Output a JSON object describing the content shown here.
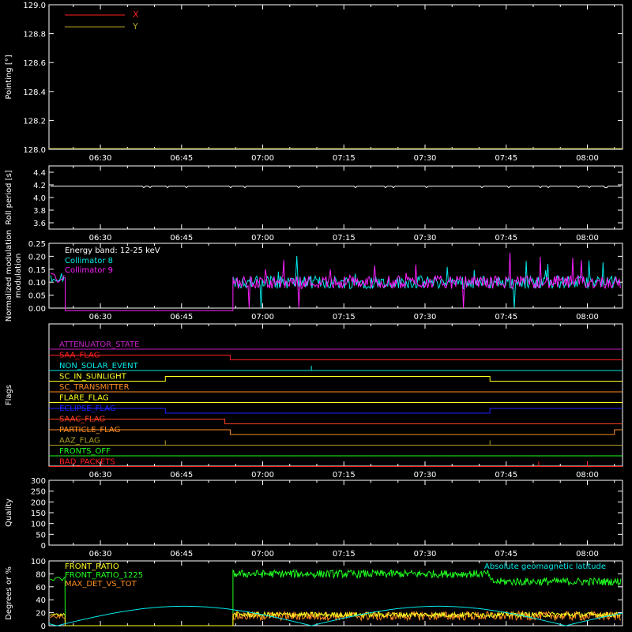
{
  "time_ticks": [
    "06:30",
    "06:45",
    "07:00",
    "07:15",
    "07:30",
    "07:45",
    "08:00"
  ],
  "colors": {
    "axis": "#ffffff",
    "red": "#ff2020",
    "olive": "#b0a020",
    "cyan": "#00e8e8",
    "magenta": "#ff20ff",
    "green": "#20ff20",
    "orange": "#ff8c20",
    "yellow": "#ffff20",
    "blue": "#2020ff",
    "purple": "#c020c0",
    "redorange": "#ff4020"
  },
  "chart_data": [
    {
      "id": "pointing",
      "type": "line",
      "ylabel": "Pointing [°]",
      "ylim": [
        128.0,
        129.0
      ],
      "yticks": [
        "128.0",
        "128.2",
        "128.4",
        "128.6",
        "128.8",
        "129.0"
      ],
      "series": [
        {
          "name": "X",
          "color": "red",
          "values": []
        },
        {
          "name": "Y",
          "color": "olive",
          "values": []
        }
      ]
    },
    {
      "id": "roll",
      "type": "line",
      "ylabel": "Roll period [s]",
      "ylim": [
        3.5,
        4.5
      ],
      "yticks": [
        "3.6",
        "3.8",
        "4.0",
        "4.2",
        "4.4"
      ],
      "series": [
        {
          "name": "",
          "color": "axis",
          "value": 4.18
        }
      ]
    },
    {
      "id": "modulation",
      "type": "line",
      "ylabel": "Normalized modulation",
      "ylim": [
        0.0,
        0.25
      ],
      "yticks": [
        "0.00",
        "0.05",
        "0.10",
        "0.15",
        "0.20",
        "0.25"
      ],
      "annotation": "Energy band: 12-25 keV",
      "series": [
        {
          "name": "Collimator 8",
          "color": "cyan",
          "before_gap": 0.12,
          "after_gap": 0.1
        },
        {
          "name": "Collimator 9",
          "color": "magenta",
          "before_gap": 0.12,
          "after_gap": 0.1
        }
      ]
    },
    {
      "id": "flags",
      "type": "line",
      "ylabel": "Flags",
      "flags": [
        {
          "name": "ATTENUATOR_STATE",
          "color": "purple",
          "steps": []
        },
        {
          "name": "SAA_FLAG",
          "color": "red",
          "steps": [
            {
              "t": "06:54",
              "dir": -1
            }
          ]
        },
        {
          "name": "NON_SOLAR_EVENT",
          "color": "cyan",
          "steps": [],
          "spikes": [
            "07:09"
          ]
        },
        {
          "name": "SC_IN_SUNLIGHT",
          "color": "yellow",
          "steps": [
            {
              "t": "06:42",
              "dir": 1
            },
            {
              "t": "07:42",
              "dir": -1
            }
          ]
        },
        {
          "name": "SC_TRANSMITTER",
          "color": "orange",
          "steps": []
        },
        {
          "name": "FLARE_FLAG",
          "color": "yellow",
          "steps": []
        },
        {
          "name": "ECLIPSE_FLAG",
          "color": "blue",
          "steps": [
            {
              "t": "06:42",
              "dir": -1
            },
            {
              "t": "07:42",
              "dir": 1
            }
          ]
        },
        {
          "name": "SAAC_FLAG",
          "color": "redorange",
          "steps": [
            {
              "t": "06:53",
              "dir": -1
            }
          ]
        },
        {
          "name": "PARTICLE_FLAG",
          "color": "orange",
          "steps": [
            {
              "t": "06:54",
              "dir": -1
            },
            {
              "t": "08:05",
              "dir": 1
            }
          ]
        },
        {
          "name": "AAZ_FLAG",
          "color": "olive",
          "steps": [],
          "spikes": [
            "06:42",
            "07:42"
          ]
        },
        {
          "name": "FRONTS_OFF",
          "color": "green",
          "steps": []
        },
        {
          "name": "BAD_PACKETS",
          "color": "red",
          "steps": [],
          "spikes": [
            "07:51",
            "08:00"
          ]
        }
      ]
    },
    {
      "id": "quality",
      "type": "line",
      "ylabel": "Quality",
      "ylim": [
        0,
        300
      ],
      "yticks": [
        "0",
        "50",
        "100",
        "150",
        "200",
        "250",
        "300"
      ],
      "series": []
    },
    {
      "id": "front",
      "type": "line",
      "ylabel": "Degrees or %",
      "ylim": [
        0,
        100
      ],
      "yticks": [
        "0",
        "20",
        "40",
        "60",
        "80",
        "100"
      ],
      "right_annotation": "Absolute geomagnetic latitude",
      "series": [
        {
          "name": "FRONT_RATIO",
          "color": "yellow",
          "level": 17
        },
        {
          "name": "FRONT_RATIO_1225",
          "color": "green",
          "level": 80
        },
        {
          "name": "MAX_DET_VS_TOT",
          "color": "orange",
          "level": 15
        }
      ]
    }
  ]
}
